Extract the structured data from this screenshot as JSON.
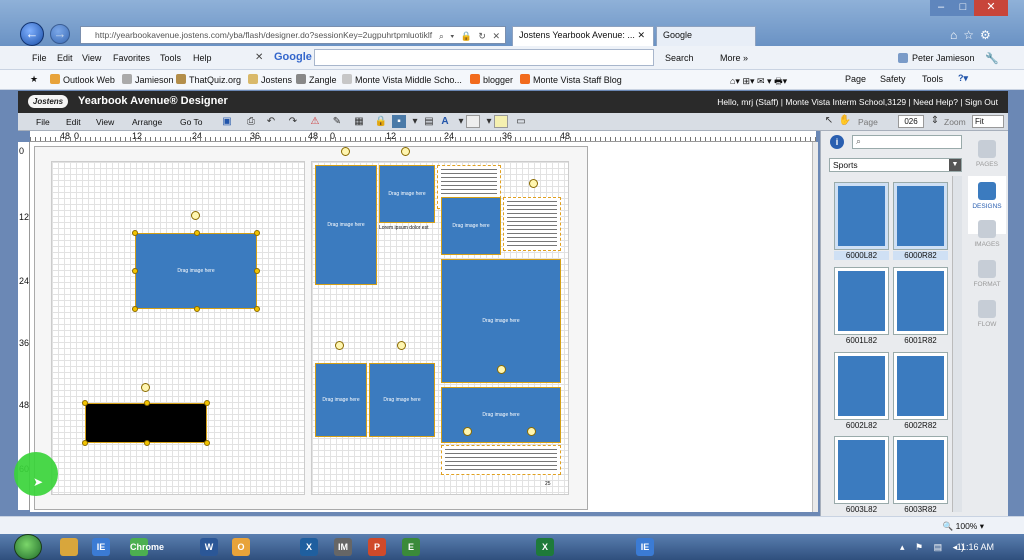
{
  "browser": {
    "url": "http://yearbookavenue.jostens.com/yba/flash/designer.do?sessionKey=2ugpuhrtpmluotiklf",
    "tabs": [
      {
        "label": "Jostens Yearbook Avenue: ...",
        "active": true
      },
      {
        "label": "Google",
        "active": false
      }
    ],
    "menu": [
      "File",
      "Edit",
      "View",
      "Favorites",
      "Tools",
      "Help"
    ],
    "search_engine": "Google",
    "search_button": "Search",
    "more_button": "More »",
    "user": "Peter Jamieson",
    "favorites": [
      "Outlook Web",
      "Jamieson",
      "ThatQuiz.org",
      "Jostens",
      "Zangle",
      "Monte Vista Middle Scho...",
      "blogger",
      "Monte Vista Staff Blog"
    ],
    "command_bar": [
      "Page",
      "Safety",
      "Tools"
    ]
  },
  "app": {
    "logo": "Jostens",
    "title": "Yearbook Avenue® Designer",
    "greeting": "Hello, mrj (Staff) | Monte Vista Interm School,3129 | Need Help? | Sign Out",
    "menu": [
      "File",
      "Edit",
      "View",
      "Arrange",
      "Go To"
    ],
    "page_label": "Page",
    "page_number": "026",
    "zoom_label": "Zoom",
    "zoom_value": "Fit"
  },
  "canvas": {
    "ruler_h": [
      "48",
      "0",
      "12",
      "24",
      "36",
      "48",
      "0",
      "12",
      "24",
      "36",
      "48"
    ],
    "ruler_v": [
      "0",
      "12",
      "24",
      "36",
      "48",
      "60"
    ],
    "placeholder_text": "Drag image here",
    "text_title": "Lorem ipsum dolor est",
    "page_num": "25"
  },
  "panel": {
    "category": "Sports",
    "designs": [
      [
        "6000L82",
        "6000R82"
      ],
      [
        "6001L82",
        "6001R82"
      ],
      [
        "6002L82",
        "6002R82"
      ],
      [
        "6003L82",
        "6003R82"
      ]
    ],
    "side_tabs": [
      "PAGES",
      "DESIGNS",
      "IMAGES",
      "FORMAT",
      "FLOW"
    ]
  },
  "status": {
    "zoom": "100%"
  },
  "taskbar": {
    "time": "11:16 AM",
    "apps": [
      "IE",
      "Chrome",
      "W",
      "O",
      "X",
      "IM",
      "P",
      "E",
      "X",
      "IE"
    ]
  }
}
